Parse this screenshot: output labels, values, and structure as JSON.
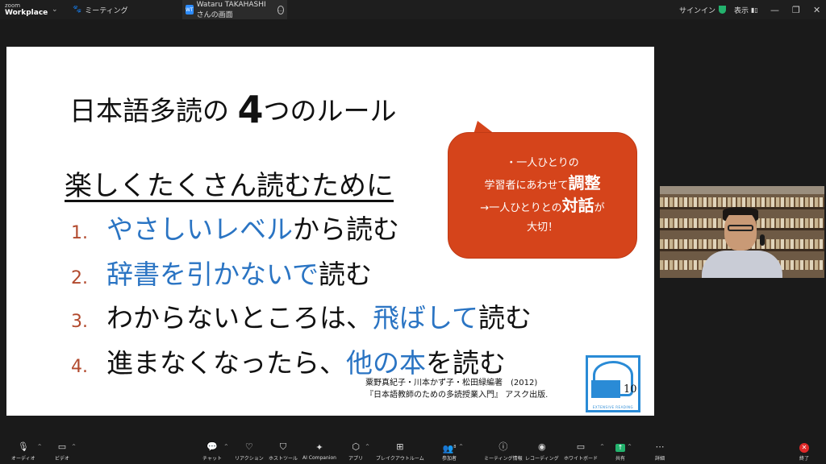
{
  "titlebar": {
    "brand_top": "zoom",
    "brand_bottom": "Workplace",
    "chevron": "⌄",
    "meeting_label": "ミーティング",
    "share_badge": "WT",
    "share_label": "Wataru TAKAHASHI さんの画面",
    "share_more": "…",
    "signin_label": "サインイン",
    "view_label": "表示",
    "win_minimize": "—",
    "win_restore": "❐",
    "win_close": "✕"
  },
  "slide": {
    "title_prefix": "日本語多読の ",
    "title_number": "4",
    "title_suffix": "つのルール",
    "subtitle": "楽しくたくさん読むために",
    "rules": [
      {
        "num": "1.",
        "blue": "やさしいレベル",
        "rest": "から読む"
      },
      {
        "num": "2.",
        "blue": "辞書を引かないで",
        "rest": "読む"
      },
      {
        "num": "3.",
        "pre": "わからないところは、",
        "blue": "飛ばして",
        "rest": "読む"
      },
      {
        "num": "4.",
        "pre": "進まなくなったら、",
        "blue": "他の本",
        "rest": "を読む"
      }
    ],
    "bubble": {
      "line1": "・一人ひとりの",
      "line2_pre": "学習者にあわせて",
      "line2_big": "調整",
      "line3_pre": "→一人ひとりとの",
      "line3_big": "対話",
      "line3_post": "が",
      "line4": "大切！"
    },
    "citation": {
      "line1": "粟野真紀子・川本かず子・松田緑編著　(2012)",
      "line2": "『日本語教師のための多読授業入門』 アスク出版."
    },
    "logo": {
      "number": "10",
      "label": "EXTENSIVE READING"
    }
  },
  "toolbar": {
    "audio": "オーディオ",
    "video": "ビデオ",
    "chat": "チャット",
    "reaction": "リアクション",
    "host_tools": "ホストツール",
    "ai_companion": "AI Companion",
    "apps": "アプリ",
    "breakout": "ブレイクアウトルーム",
    "participants": "参加者",
    "participants_count": "8",
    "meeting_info": "ミーティング情報",
    "recording": "レコーディング",
    "whiteboard": "ホワイトボード",
    "share": "共有",
    "details": "詳細",
    "end": "終了"
  },
  "colors": {
    "accent_blue": "#2a74c3",
    "bubble_orange": "#d5441b",
    "number_red": "#b24a2e",
    "share_green": "#23b26d",
    "end_red": "#e02828"
  }
}
